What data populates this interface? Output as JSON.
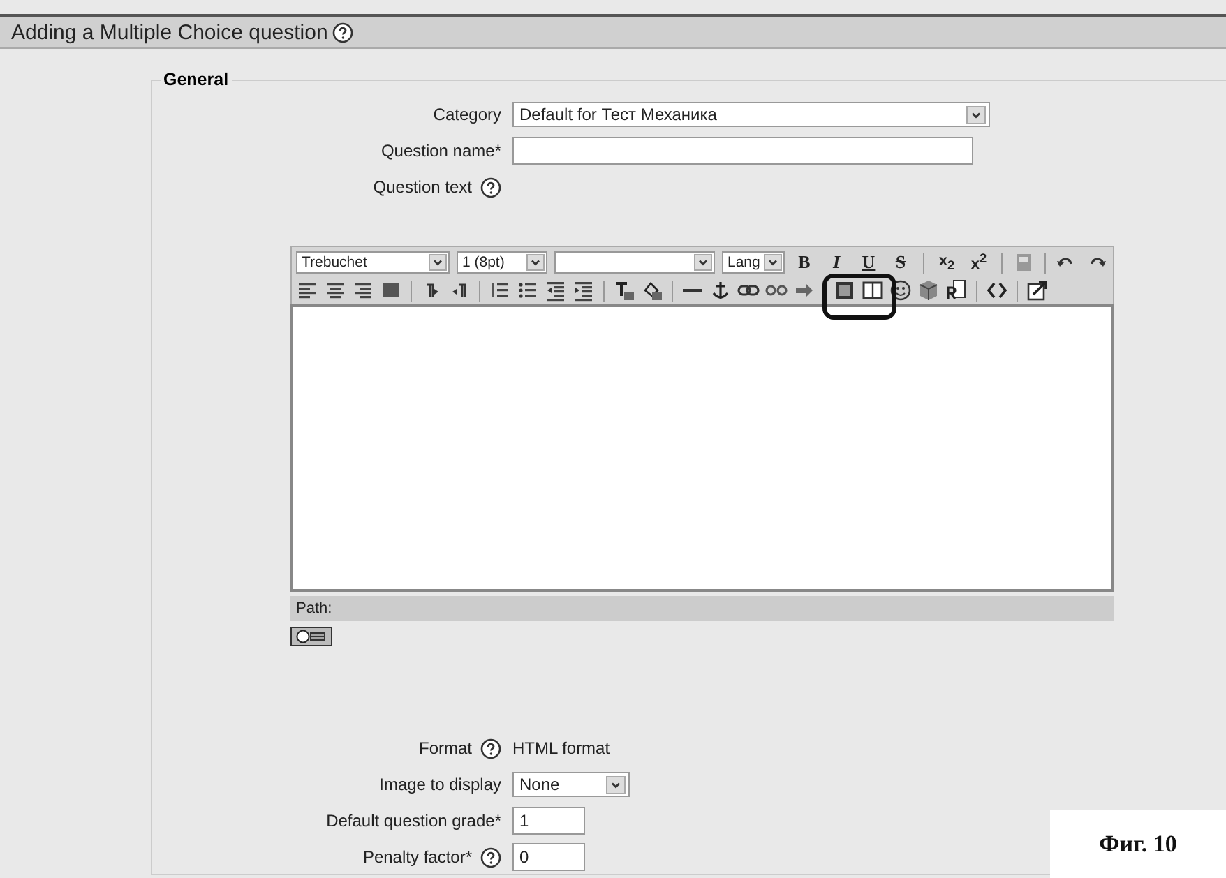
{
  "page_title": "Adding a Multiple Choice question",
  "section": {
    "legend": "General"
  },
  "fields_top": [
    {
      "kind": "select",
      "label": "Category",
      "help": false,
      "value": "Default for Тест Механика"
    },
    {
      "kind": "text",
      "label": "Question name*",
      "help": false
    },
    {
      "kind": "editor-label",
      "label": "Question text",
      "help": true
    }
  ],
  "editor": {
    "font": "Trebuchet",
    "size": "1 (8pt)",
    "lang": "Lang",
    "text_buttons": [
      {
        "label": "B"
      },
      {
        "label": "I"
      },
      {
        "label": "U"
      },
      {
        "label": "S"
      },
      {
        "label": "x$_{2}$"
      },
      {
        "label": "x$^{2}$"
      }
    ],
    "path_label": "Path:"
  },
  "fields_bottom": [
    {
      "kind": "static",
      "label": "Format",
      "help": true,
      "value": "HTML format"
    },
    {
      "kind": "select",
      "label": "Image to display",
      "help": false,
      "value": "None"
    },
    {
      "kind": "text",
      "label": "Default question grade*",
      "help": false,
      "value": "1"
    },
    {
      "kind": "text",
      "label": "Penalty factor*",
      "help": true,
      "value": "0"
    }
  ],
  "caption": "Фиг. 10"
}
